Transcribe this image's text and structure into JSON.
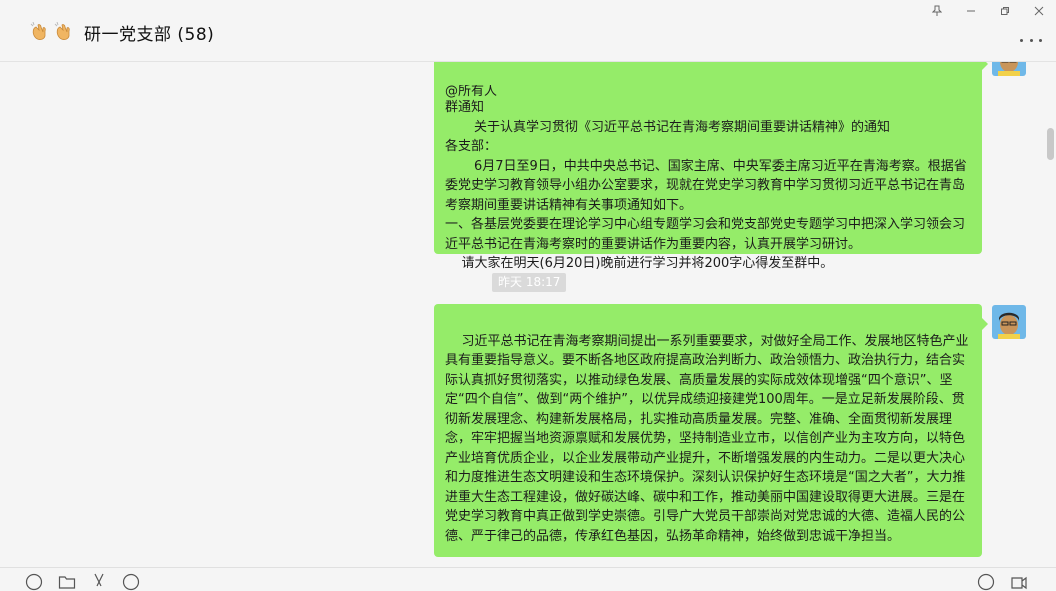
{
  "header": {
    "title": "研一党支部 (58)",
    "emoji_icons": [
      "clapping-hands-icon",
      "clapping-hands-icon"
    ],
    "window_controls": [
      "pin-icon",
      "minimize-icon",
      "restore-icon",
      "close-icon"
    ],
    "more_icon": "more-dots-icon"
  },
  "messages": [
    {
      "type": "outgoing",
      "partial_top": "@所有人",
      "text": "群通知\n       关于认真学习贯彻《习近平总书记在青海考察期间重要讲话精神》的通知\n各支部：\n       6月7日至9日，中共中央总书记、国家主席、中央军委主席习近平在青海考察。根据省委党史学习教育领导小组办公室要求，现就在党史学习教育中学习贯彻习近平总书记在青岛考察期间重要讲话精神有关事项通知如下。\n一、各基层党委要在理论学习中心组专题学习会和党支部党史专题学习中把深入学习领会习近平总书记在青海考察时的重要讲话作为重要内容，认真开展学习研讨。\n    请大家在明天(6月20日)晚前进行学习并将200字心得发至群中。"
    },
    {
      "type": "outgoing",
      "text": "习近平总书记在青海考察期间提出一系列重要要求，对做好全局工作、发展地区特色产业具有重要指导意义。要不断各地区政府提高政治判断力、政治领悟力、政治执行力，结合实际认真抓好贯彻落实，以推动绿色发展、高质量发展的实际成效体现增强“四个意识”、坚定“四个自信”、做到“两个维护”，以优异成绩迎接建党100周年。一是立足新发展阶段、贯彻新发展理念、构建新发展格局，扎实推动高质量发展。完整、准确、全面贯彻新发展理念，牢牢把握当地资源禀赋和发展优势，坚持制造业立市，以信创产业为主攻方向，以特色产业培育优质企业，以企业发展带动产业提升，不断增强发展的内生动力。二是以更大决心和力度推进生态文明建设和生态环境保护。深刻认识保护好生态环境是“国之大者”，大力推进重大生态工程建设，做好碳达峰、碳中和工作，推动美丽中国建设取得更大进展。三是在党史学习教育中真正做到学史崇德。引导广大党员干部崇尚对党忠诚的大德、造福人民的公德、严于律己的品德，传承红色基因，弘扬革命精神，始终做到忠诚干净担当。"
    }
  ],
  "timestamp": "昨天 18:17",
  "colors": {
    "bubble": "#95ec69",
    "background": "#f5f5f5",
    "timestamp_bg": "#dadada"
  },
  "footer_icons": [
    "emoji-icon",
    "folder-icon",
    "scissors-icon",
    "chat-history-icon",
    "voice-call-icon",
    "video-call-icon"
  ]
}
